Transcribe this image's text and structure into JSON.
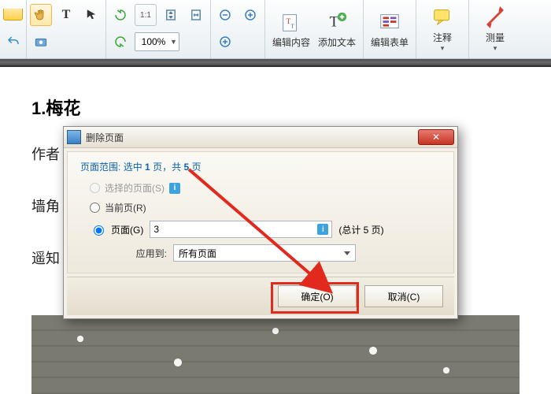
{
  "toolbar": {
    "zoom_value": "100%",
    "edit_content": "编辑内容",
    "add_text": "添加文本",
    "edit_form": "编辑表单",
    "annotate": "注释",
    "measure": "测量"
  },
  "document": {
    "heading": "1.梅花",
    "author_prefix": "作者",
    "line2": "墙角",
    "line3": "遥知"
  },
  "dialog": {
    "title": "删除页面",
    "range_prefix": "页面范围:",
    "range_mid1": "选中",
    "range_mid2": "页，共",
    "range_sel": "1",
    "range_total": "5",
    "range_suffix": "页",
    "opt_selected": "选择的页面(S)",
    "opt_current": "当前页(R)",
    "opt_pages": "页面(G)",
    "page_value": "3",
    "total_hint": "(总计 5 页)",
    "apply_to_label": "应用到:",
    "apply_to_value": "所有页面",
    "ok": "确定(O)",
    "cancel": "取消(C)"
  }
}
